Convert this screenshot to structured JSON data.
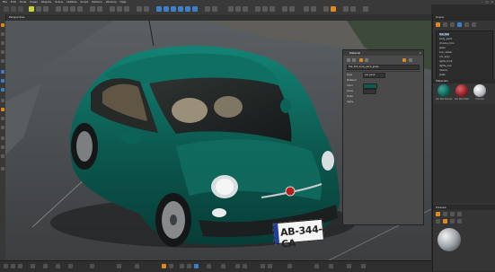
{
  "menubar": {
    "items": [
      "File",
      "Edit",
      "Tools",
      "Views",
      "Objects",
      "Scene",
      "Utilities",
      "Script",
      "Options",
      "Window",
      "Help"
    ]
  },
  "viewport": {
    "title": "Perspective"
  },
  "dialog": {
    "title": "Material",
    "name_value": "Fiat_500_body_paint_green",
    "rows": [
      "Type",
      "Material",
      "Color",
      "Gloss",
      "Flake",
      "Apply"
    ],
    "preset_value": "Car paint"
  },
  "scene": {
    "plate_text": "AB-344-CA"
  },
  "right_panel": {
    "scene_header": "Scene",
    "tree": [
      "Fiat_500",
      "body_paint",
      "chrome_trim",
      "glass",
      "tire_rubber",
      "rim_alloy",
      "lights_front",
      "lights_rear",
      "interior",
      "plate"
    ],
    "materials_header": "Materials",
    "materials": [
      {
        "name": "Car Paint Green",
        "color": "#0e5f55"
      },
      {
        "name": "Car Paint Red",
        "color": "#8d1d24"
      },
      {
        "name": "Chrome",
        "color": "#b8bcc2"
      }
    ],
    "preview_header": "Preview"
  },
  "colors": {
    "car_paint": "#0c5a50",
    "ui_accent": "#e08a1e",
    "ui_blue": "#3d7fc4"
  }
}
